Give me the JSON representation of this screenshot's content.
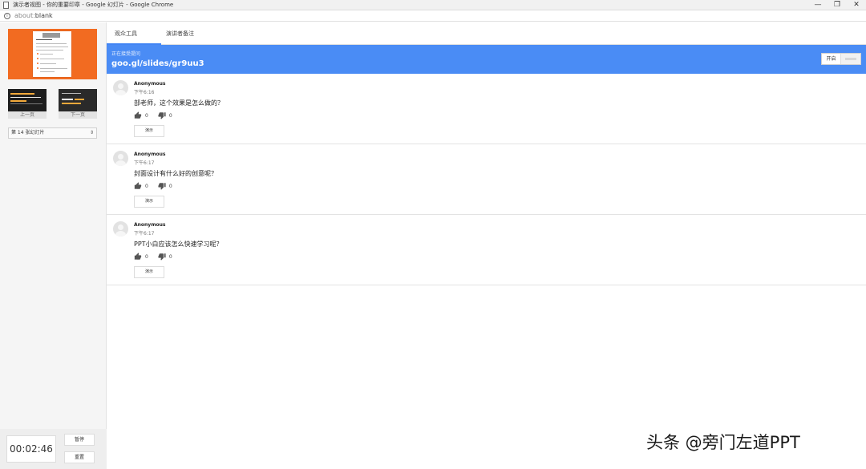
{
  "window": {
    "title": "演示者视图 - 你的重要印章 - Google 幻灯片 - Google Chrome",
    "minimize_glyph": "—",
    "restore_glyph": "❐",
    "close_glyph": "✕"
  },
  "address": {
    "scheme": "about:",
    "page": "blank"
  },
  "left_panel": {
    "prev_label": "上一页",
    "next_label": "下一页",
    "slide_select": "第 14 张幻灯片",
    "timer": "00:02:46",
    "pause_label": "暂停",
    "reset_label": "重置"
  },
  "tabs": [
    {
      "label": "观众工具",
      "active": true
    },
    {
      "label": "演讲者备注",
      "active": false
    }
  ],
  "banner": {
    "status": "正在接受提问",
    "link": "goo.gl/slides/gr9uu3",
    "toggle_label": "开启",
    "color": "#4a8cf5"
  },
  "questions": [
    {
      "author": "Anonymous",
      "time": "下午6:16",
      "text": "部老师，这个效果是怎么做的？",
      "likes": "0",
      "dislikes": "0",
      "present_label": "演示"
    },
    {
      "author": "Anonymous",
      "time": "下午6:17",
      "text": "封面设计有什么好的创意呢？",
      "likes": "0",
      "dislikes": "0",
      "present_label": "演示"
    },
    {
      "author": "Anonymous",
      "time": "下午6:17",
      "text": "PPT小白应该怎么快速学习呢？",
      "likes": "0",
      "dislikes": "0",
      "present_label": "演示"
    }
  ],
  "watermark": "头条 @旁门左道PPT"
}
